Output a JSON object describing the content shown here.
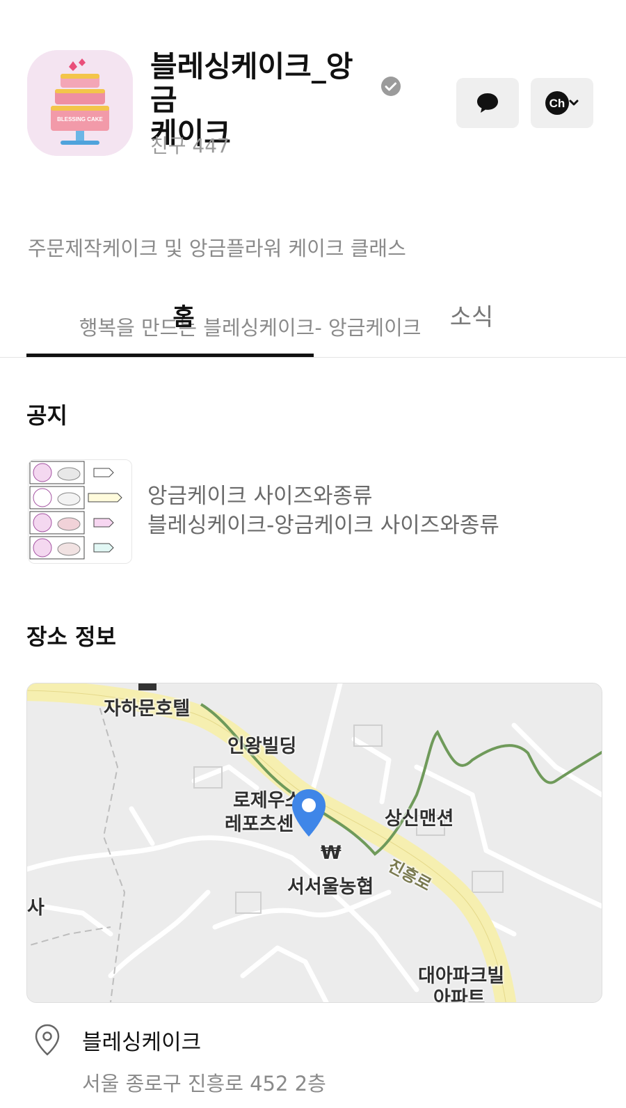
{
  "profile": {
    "name_line1": "블레싱케이크_앙금",
    "name_line2": "케이크",
    "logo_text": "BLESSING CAKE",
    "friends": "친구 447",
    "description_line1": "주문제작케이크 및 앙금플라워 케이크 클래스",
    "description_line2": "        행복을 만드는 블레싱케이크- 앙금케이크"
  },
  "actions": {
    "chat_icon": "speech-bubble-icon",
    "channel_icon": "ch-dropdown-icon",
    "channel_label": "Ch"
  },
  "tabs": [
    {
      "label": "홈",
      "active": true
    },
    {
      "label": "소식",
      "active": false
    }
  ],
  "notice": {
    "section_title": "공지",
    "line1": "앙금케이크 사이즈와종류",
    "line2": "블레싱케이크-앙금케이크 사이즈와종류"
  },
  "place": {
    "section_title": "장소 정보",
    "map_labels": {
      "hotel": "자하문호텔",
      "inwang": "인왕빌딩",
      "rose1": "로제우스",
      "rose2": "레포츠센",
      "sangsin": "상신맨션",
      "jinheung": "진흥로",
      "bank": "서서울농협",
      "won": "₩",
      "sa": "사",
      "daea1": "대아파크빌",
      "daea2": "아파트"
    },
    "name": "블레싱케이크",
    "address": "서울 종로구 진흥로 452 2층"
  },
  "colors": {
    "accent_pin": "#3f86e8",
    "road_main": "#f6efb0",
    "trail": "#6f9a5a"
  }
}
